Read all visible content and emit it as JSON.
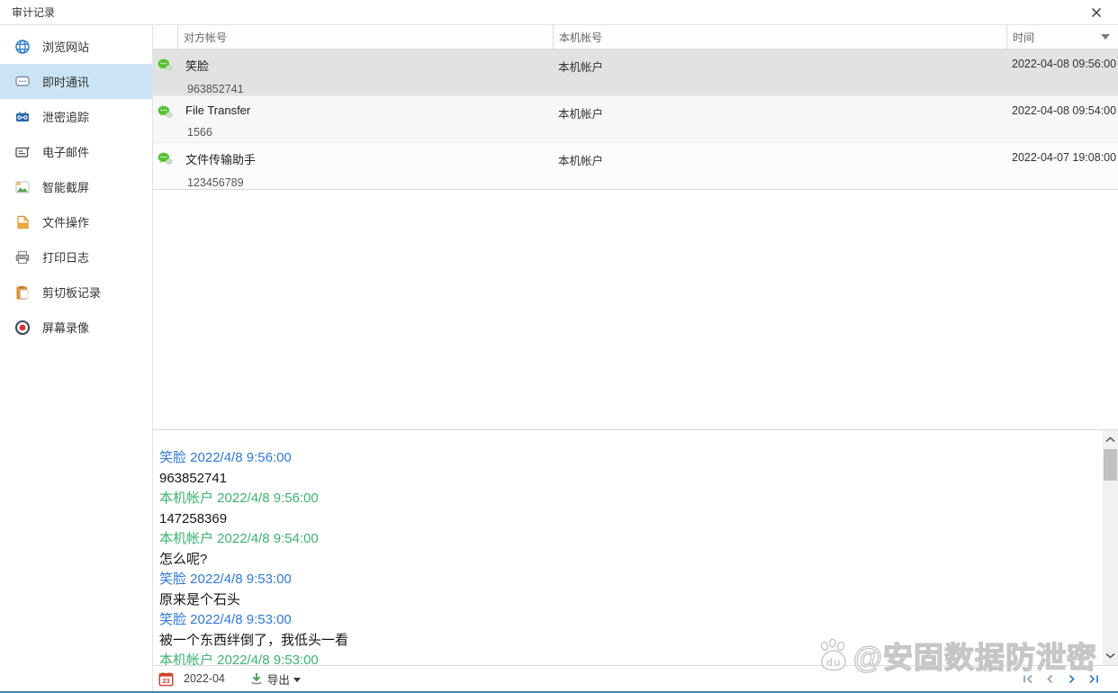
{
  "window": {
    "title": "审计记录"
  },
  "sidebar": {
    "items": [
      {
        "label": "浏览网站",
        "icon": "globe-icon",
        "selected": false
      },
      {
        "label": "即时通讯",
        "icon": "chat-bubble-icon",
        "selected": true
      },
      {
        "label": "泄密追踪",
        "icon": "tracker-icon",
        "selected": false
      },
      {
        "label": "电子邮件",
        "icon": "envelope-icon",
        "selected": false
      },
      {
        "label": "智能截屏",
        "icon": "screenshot-icon",
        "selected": false
      },
      {
        "label": "文件操作",
        "icon": "document-icon",
        "selected": false
      },
      {
        "label": "打印日志",
        "icon": "printer-icon",
        "selected": false
      },
      {
        "label": "剪切板记录",
        "icon": "clipboard-icon",
        "selected": false
      },
      {
        "label": "屏幕录像",
        "icon": "record-icon",
        "selected": false
      }
    ]
  },
  "table": {
    "columns": {
      "peer": "对方帐号",
      "local": "本机帐号",
      "time": "时间"
    },
    "rows": [
      {
        "name": "笑脸",
        "account": "963852741",
        "local_account": "本机帐户",
        "time": "2022-04-08 09:56:00",
        "selected": true
      },
      {
        "name": "File Transfer",
        "account": "1566",
        "local_account": "本机帐户",
        "time": "2022-04-08 09:54:00",
        "selected": false
      },
      {
        "name": "文件传输助手",
        "account": "123456789",
        "local_account": "本机帐户",
        "time": "2022-04-07 19:08:00",
        "selected": false
      }
    ]
  },
  "chat": {
    "messages": [
      {
        "header": "笑脸 2022/4/8 9:56:00",
        "side": "remote",
        "text": "963852741"
      },
      {
        "header": "本机帐户 2022/4/8 9:56:00",
        "side": "local",
        "text": "147258369"
      },
      {
        "header": "本机帐户 2022/4/8 9:54:00",
        "side": "local",
        "text": "怎么呢?"
      },
      {
        "header": "笑脸 2022/4/8 9:53:00",
        "side": "remote",
        "text": "原来是个石头"
      },
      {
        "header": "笑脸 2022/4/8 9:53:00",
        "side": "remote",
        "text": "被一个东西绊倒了，我低头一看"
      },
      {
        "header": "本机帐户 2022/4/8 9:53:00",
        "side": "local",
        "text": ""
      }
    ]
  },
  "footer": {
    "date": "2022-04",
    "export_label": "导出",
    "calendar_day": "23",
    "pagination": [
      "first-page",
      "previous-page",
      "next-page",
      "last-page"
    ]
  },
  "watermark": {
    "text": "@安固数据防泄密",
    "logo": "baidu-paw-icon"
  },
  "colors": {
    "accent_blue": "#2e7cc3",
    "sidebar_selected": "#cbe4f5",
    "row_selected": "#e2e2e2",
    "chat_remote": "#2f79d8",
    "chat_local": "#3cb371",
    "wechat_green": "#57c231",
    "bottom_border": "#4183ad"
  }
}
